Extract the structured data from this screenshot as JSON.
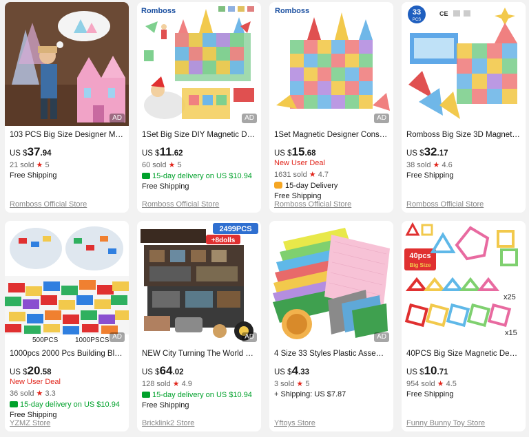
{
  "ad_label": "AD",
  "products": [
    {
      "title": "103 PCS Big Size Designer Magneti...",
      "currency": "US $",
      "price_int": "37",
      "price_dec": ".94",
      "new_user_deal": "",
      "sold": "21 sold",
      "rating": "5",
      "delivery_green": "",
      "delivery_badge": "",
      "shipping": "Free Shipping",
      "store": "Romboss Official Store"
    },
    {
      "title": "1Set Big Size DIY Magnetic Designe...",
      "currency": "US $",
      "price_int": "11",
      "price_dec": ".62",
      "new_user_deal": "",
      "sold": "60 sold",
      "rating": "5",
      "delivery_green": "15-day delivery on US $10.94",
      "delivery_badge": "",
      "shipping": "Free Shipping",
      "store": "Romboss Official Store"
    },
    {
      "title": "1Set Magnetic Designer Constructi...",
      "currency": "US $",
      "price_int": "15",
      "price_dec": ".68",
      "new_user_deal": "New User Deal",
      "sold": "1631 sold",
      "rating": "4.7",
      "delivery_green": "",
      "delivery_badge": "15-day Delivery",
      "shipping": "Free Shipping",
      "store": "Romboss Official Store"
    },
    {
      "title": "Romboss Big Size 3D Magnetic Bui...",
      "currency": "US $",
      "price_int": "32",
      "price_dec": ".17",
      "new_user_deal": "",
      "sold": "38 sold",
      "rating": "4.6",
      "delivery_green": "",
      "delivery_badge": "",
      "shipping": "Free Shipping",
      "store": "Romboss Official Store"
    },
    {
      "title": "1000pcs 2000 Pcs Building Blocks ...",
      "currency": "US $",
      "price_int": "20",
      "price_dec": ".58",
      "new_user_deal": "New User Deal",
      "sold": "36 sold",
      "rating": "3.3",
      "delivery_green": "15-day delivery on US $10.94",
      "delivery_badge": "",
      "shipping": "Free Shipping",
      "store": "YZMZ Store"
    },
    {
      "title": "NEW City Turning The World Room...",
      "currency": "US $",
      "price_int": "64",
      "price_dec": ".02",
      "new_user_deal": "",
      "sold": "128 sold",
      "rating": "4.9",
      "delivery_green": "15-day delivery on US $10.94",
      "delivery_badge": "",
      "shipping": "Free Shipping",
      "store": "Bricklink2 Store"
    },
    {
      "title": "4 Size 33 Styles Plastic Assembly Bl...",
      "currency": "US $",
      "price_int": "4",
      "price_dec": ".33",
      "new_user_deal": "",
      "sold": "3 sold",
      "rating": "5",
      "delivery_green": "",
      "delivery_badge": "",
      "shipping": "+ Shipping: US $7.87",
      "store": "Yftoys Store"
    },
    {
      "title": "40PCS Big Size Magnetic Designer ...",
      "currency": "US $",
      "price_int": "10",
      "price_dec": ".71",
      "new_user_deal": "",
      "sold": "954 sold",
      "rating": "4.5",
      "delivery_green": "",
      "delivery_badge": "",
      "shipping": "Free Shipping",
      "store": "Funny Bunny Toy Store"
    }
  ],
  "image_text": {
    "brand_logo": "Romboss",
    "pcs_33_badge": "33",
    "pcs_33_unit": "PCS",
    "pcs_label_500": "500PCS",
    "pcs_label_1000": "1000PSCS",
    "pcs_2499": "2499PCS",
    "dolls_8": "+8dolls",
    "size_40pcs": "40pcs",
    "big_size": "Big Size",
    "x25": "x25",
    "x15": "x15",
    "cert_marks": "CE"
  }
}
